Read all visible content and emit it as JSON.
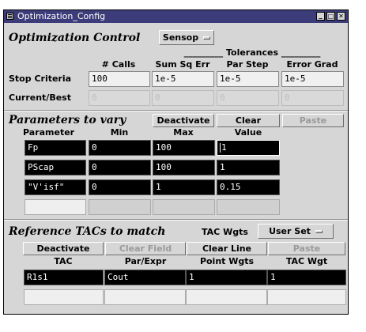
{
  "window": {
    "title": "Optimization_Config",
    "min_label": "_",
    "max_label": "□",
    "close_label": "✕"
  },
  "optimization": {
    "heading": "Optimization Control",
    "method_value": "Sensop",
    "tolerances_label": "_________ Tolerances _________",
    "columns": [
      "# Calls",
      "Sum Sq Err",
      "Par Step",
      "Error Grad"
    ],
    "stop_label": "Stop Criteria",
    "stop_values": [
      "100",
      "1e-5",
      "1e-5",
      "1e-5"
    ],
    "current_label": "Current/Best",
    "current_values": [
      "0",
      "0",
      "0",
      "0"
    ]
  },
  "parameters": {
    "heading": "Parameters to vary",
    "buttons": {
      "deactivate": "Deactivate",
      "clear": "Clear",
      "paste": "Paste"
    },
    "columns": [
      "Parameter",
      "Min",
      "Max",
      "Value"
    ],
    "rows": [
      {
        "name": "Fp",
        "min": "0",
        "max": "100",
        "value": "1"
      },
      {
        "name": "PScap",
        "min": "0",
        "max": "100",
        "value": "1"
      },
      {
        "name": "\"V'isf\"",
        "min": "0",
        "max": "1",
        "value": "0.15"
      }
    ]
  },
  "reference": {
    "heading": "Reference TACs to match",
    "wgts_label": "TAC Wgts",
    "wgts_value": "User Set",
    "buttons": {
      "deactivate": "Deactivate",
      "clear_field": "Clear Field",
      "clear_line": "Clear Line",
      "paste": "Paste"
    },
    "columns": [
      "TAC",
      "Par/Expr",
      "Point Wgts",
      "TAC Wgt"
    ],
    "rows": [
      {
        "tac": "R1s1",
        "expr": "Cout",
        "point_wgts": "1",
        "tac_wgt": "1"
      }
    ]
  }
}
